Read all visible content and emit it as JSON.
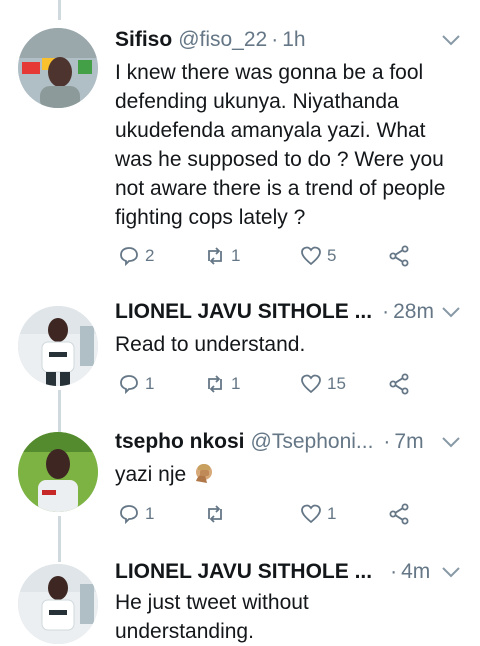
{
  "tweets": [
    {
      "name": "Sifiso",
      "handle": "@fiso_22",
      "time": "1h",
      "text": [
        "I knew there was gonna be a fool",
        "defending ukunya. Niyathanda",
        "ukudefenda amanyala yazi. What",
        "was he supposed to do ? Were you",
        "not aware there is a trend of people",
        "fighting cops lately ?"
      ],
      "replies": "2",
      "retweets": "1",
      "likes": "5"
    },
    {
      "name": "LIONEL JAVU SITHOLE ...",
      "handle": "",
      "time": "28m",
      "text": [
        "Read to understand."
      ],
      "replies": "1",
      "retweets": "1",
      "likes": "15"
    },
    {
      "name": "tsepho nkosi",
      "handle": "@Tsephoni...",
      "time": "7m",
      "text": [
        "yazi nje"
      ],
      "replies": "1",
      "retweets": "",
      "likes": "1"
    },
    {
      "name": "LIONEL JAVU SITHOLE ...",
      "handle": "",
      "time": "4m",
      "text": [
        "He just tweet without",
        "understanding."
      ],
      "replies": "",
      "retweets": "",
      "likes": ""
    }
  ],
  "icons": {
    "reply": "reply-icon",
    "retweet": "retweet-icon",
    "like": "heart-icon",
    "share": "share-icon",
    "menu": "chevron-down-icon"
  },
  "colors": {
    "text": "#14171a",
    "muted": "#657786",
    "thread": "#cfd9de"
  }
}
